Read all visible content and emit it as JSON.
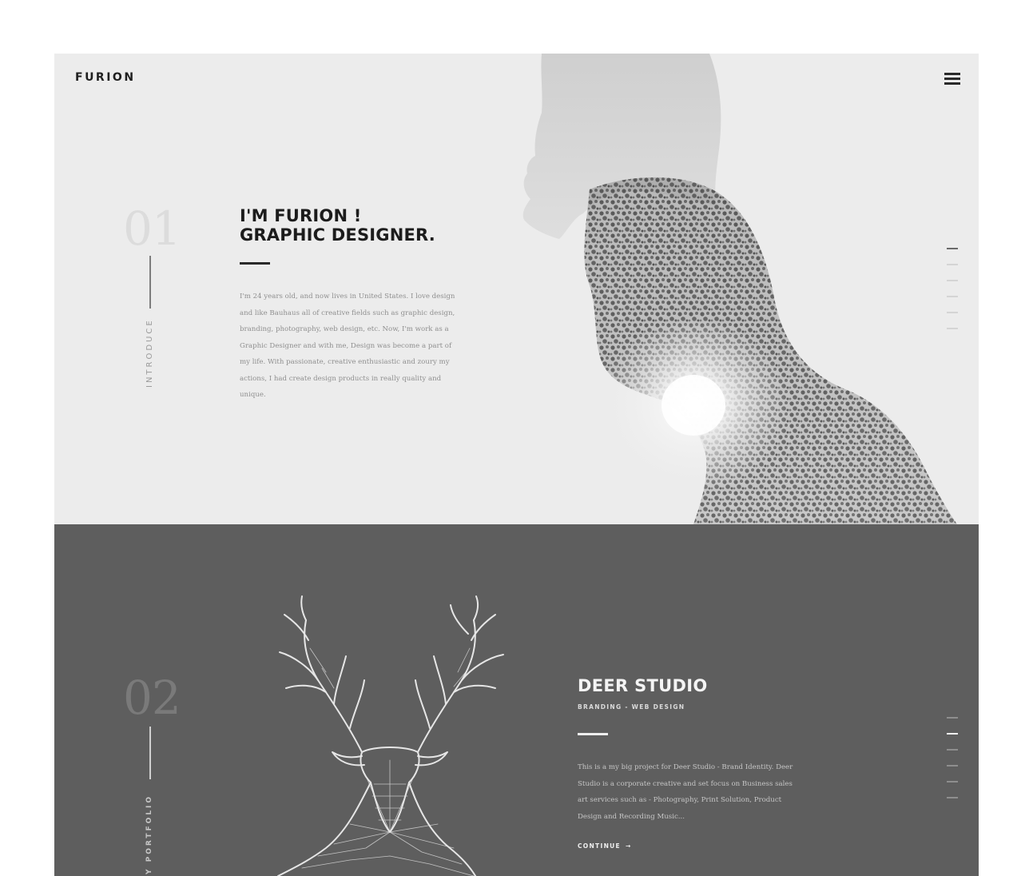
{
  "header": {
    "logo": "FURION"
  },
  "intro": {
    "number": "01",
    "side_label": "INTRODUCE",
    "heading_line1": "I'M FURION !",
    "heading_line2": "GRAPHIC DESIGNER.",
    "body": "I'm 24 years old, and now lives in United States. I love design and like Bauhaus all of creative fields such as graphic design, branding, photography, web design, etc. Now, I'm work as a Graphic Designer and with me, Design was become a part of my life. With passionate, creative enthusiastic and zoury my actions, I had create design products in really quality and unique."
  },
  "portfolio": {
    "number": "02",
    "side_label": "MY PORTFOLIO",
    "title": "DEER STUDIO",
    "subtitle": "BRANDING - WEB DESIGN",
    "body": "This is a my big project for Deer Studio - Brand Identity. Deer Studio is a corporate creative and set focus on Business sales art services such as - Photography, Print Solution, Product Design and Recording Music...",
    "cta_label": "CONTINUE",
    "cta_arrow": "→"
  },
  "section_nav": {
    "count": 6,
    "intro_active_index": 0,
    "portfolio_active_index": 1
  },
  "colors": {
    "intro_background": "#ececec",
    "portfolio_background": "#5e5e5e",
    "text_dark": "#1c1c1c",
    "text_light": "#f4f4f4"
  }
}
